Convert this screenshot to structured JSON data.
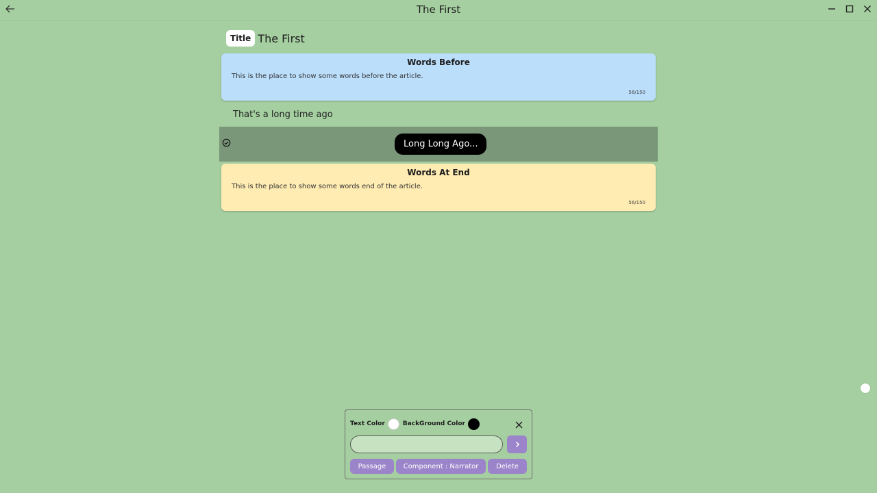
{
  "window": {
    "title": "The First"
  },
  "title_row": {
    "chip": "Title",
    "text": "The First"
  },
  "cards": {
    "before": {
      "title": "Words Before",
      "body": "This is the place to show some words before the article.",
      "count": "56/150"
    },
    "end": {
      "title": "Words At End",
      "body": "This is the place to show some words end of the article.",
      "count": "56/150"
    }
  },
  "subtitle": "That's a long time ago",
  "selected_row": {
    "bubble": "Long Long Ago..."
  },
  "panel": {
    "text_color_label": "Text Color",
    "background_color_label": "BackGround Color",
    "input_value": "",
    "buttons": {
      "passage": "Passage",
      "component": "Component : Narrator",
      "delete": "Delete"
    }
  },
  "icons": {
    "back": "arrow-left-icon",
    "minimize": "minimize-icon",
    "maximize": "maximize-icon",
    "close": "close-icon",
    "check": "check-circle-icon",
    "next": "chevron-right-icon"
  },
  "colors": {
    "background": "#a5cfa0",
    "card_before": "#bbdefb",
    "card_end": "#ffecb3",
    "selected_row": "#7a977a",
    "accent": "#9b84c9",
    "text_color": "#ffffff",
    "background_color": "#000000"
  }
}
